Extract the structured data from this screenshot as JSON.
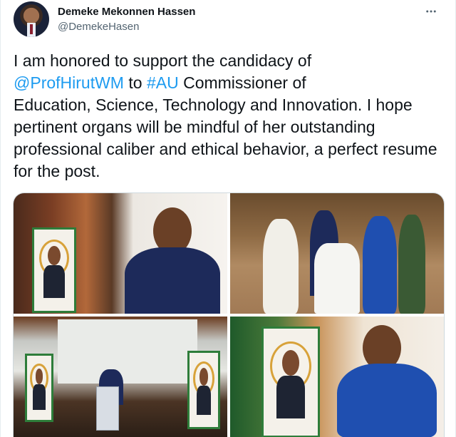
{
  "author": {
    "display_name": "Demeke Mekonnen Hassen",
    "handle": "@DemekeHasen",
    "avatar_icon": "profile-photo"
  },
  "tweet": {
    "line1_pre": "I am honored to support the candidacy of",
    "mention": "@ProfHirutWM",
    "mid": " to ",
    "hashtag": "#AU",
    "line2_post": " Commissioner of",
    "rest": "Education, Science, Technology and Innovation. I hope pertinent organs will be mindful of her outstanding professional caliber and ethical behavior, a perfect resume for the post."
  },
  "menu": {
    "more_icon": "more-horizontal-icon"
  },
  "colors": {
    "link": "#1d9bf0",
    "text": "#0f1419",
    "secondary": "#536471",
    "border": "#cfd9de"
  },
  "media": {
    "count": 4,
    "photos": [
      {
        "subject": "speaker-at-podium-photo"
      },
      {
        "subject": "guests-standing-photo"
      },
      {
        "subject": "stage-lectern-photo"
      },
      {
        "subject": "woman-in-blue-dress-photo"
      }
    ]
  }
}
